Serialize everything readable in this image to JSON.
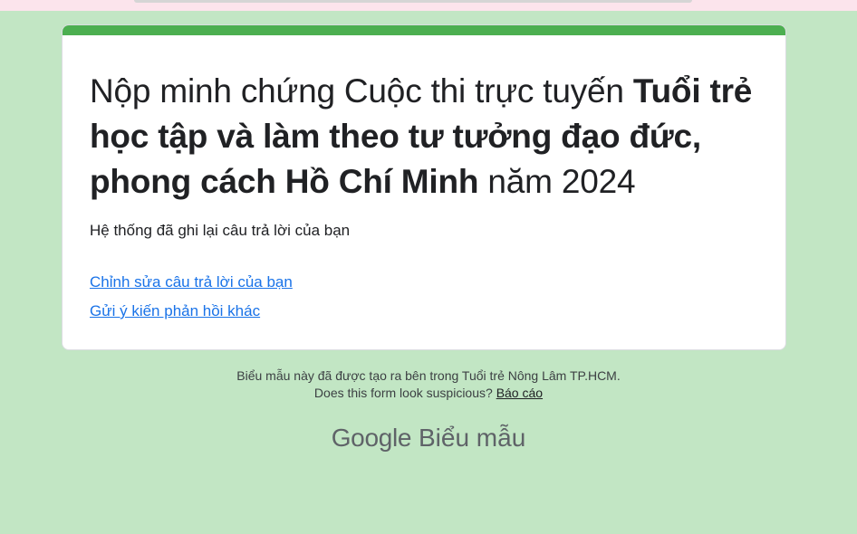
{
  "form": {
    "title_prefix": "Nộp minh chứng Cuộc thi trực tuyến ",
    "title_bold": "Tuổi trẻ học tập và làm theo tư tưởng đạo đức, phong cách Hồ Chí Minh",
    "title_suffix": " năm 2024",
    "confirmation": "Hệ thống đã ghi lại câu trả lời của bạn",
    "edit_link": "Chỉnh sửa câu trả lời của bạn",
    "other_response_link": "Gửi ý kiến phản hồi khác"
  },
  "footer": {
    "created_in": "Biểu mẫu này đã được tạo ra bên trong Tuổi trẻ Nông Lâm TP.HCM.",
    "suspicious_text": "Does this form look suspicious? ",
    "report_link": "Báo cáo"
  },
  "brand": {
    "google": "Google",
    "product": "Biểu mẫu"
  },
  "colors": {
    "background": "#c2e6c4",
    "accent": "#4caf50",
    "link": "#1a73e8"
  }
}
